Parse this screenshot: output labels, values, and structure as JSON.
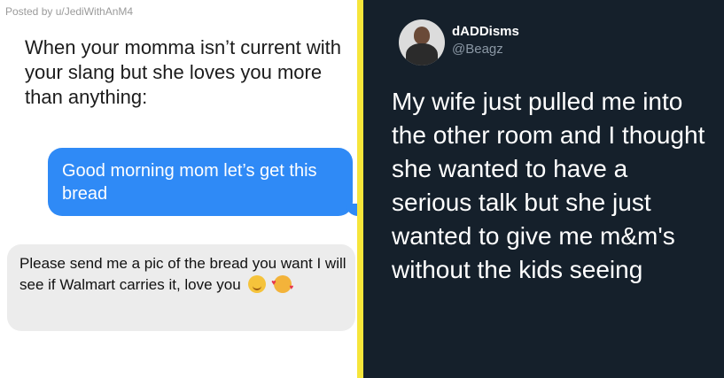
{
  "left_meme": {
    "poster": "Posted by u/JediWithAnM4",
    "caption": "When your momma isn’t current with your slang but she loves you more than anything:",
    "sent_message": "Good morning mom let’s get this bread",
    "received_message": "Please send me a pic of the bread you want I will see if Walmart carries it, love you",
    "emojis": [
      "smiling-face-emoji",
      "face-with-hearts-emoji"
    ]
  },
  "colors": {
    "sent_bubble": "#2f8af6",
    "received_bubble": "#ececec",
    "divider": "#f6e53a",
    "tweet_background": "#15202b"
  },
  "tweet": {
    "display_name": "dADDisms",
    "handle": "@Beagz",
    "text": "My wife just pulled me into the other room and I thought she wanted to have a serious talk but she just wanted to give me m&m's without the kids seeing"
  }
}
